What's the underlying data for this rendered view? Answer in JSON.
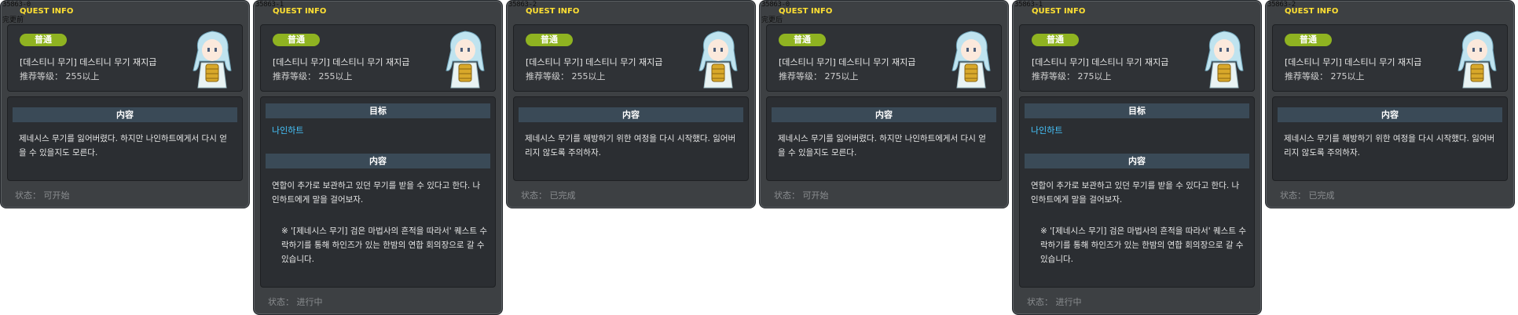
{
  "panels": [
    {
      "code": "35863-0",
      "title": "QUEST INFO",
      "subline": "完更前",
      "badge": "普通",
      "quest_name": "[데스티니 무기] 데스티니 무기 재지급",
      "level": "推荐等级： 255以上",
      "content_header": "内容",
      "content": "제네시스 무기를 잃어버렸다. 하지만 나인하트에게서 다시 얻을 수 있을지도 모른다.",
      "status": "状态： 可开始"
    },
    {
      "code": "35863-1",
      "title": "QUEST INFO",
      "subline": "",
      "badge": "普通",
      "quest_name": "[데스티니 무기] 데스티니 무기 재지급",
      "level": "推荐等级： 255以上",
      "target_header": "目标",
      "target": "나인하트",
      "content_header": "内容",
      "content": "연합이 추가로 보관하고 있던 무기를 받을 수 있다고 한다. 나인하트에게 말을 걸어보자.",
      "note": "※ '[제네시스 무기] 검은 마법사의 흔적을 따라서' 퀘스트 수락하기를 통해 하인즈가 있는 한밤의 연합 회의장으로 갈 수 있습니다.",
      "status": "状态： 进行中"
    },
    {
      "code": "35863-2",
      "title": "QUEST INFO",
      "subline": "",
      "badge": "普通",
      "quest_name": "[데스티니 무기] 데스티니 무기 재지급",
      "level": "推荐等级： 255以上",
      "content_header": "内容",
      "content": "제네시스 무기를 해방하기 위한 여정을 다시 시작했다. 잃어버리지 않도록 주의하자.",
      "status": "状态： 已完成"
    },
    {
      "code": "35863-0",
      "title": "QUEST INFO",
      "subline": "完更后",
      "badge": "普通",
      "quest_name": "[데스티니 무기] 데스티니 무기 재지급",
      "level": "推荐等级： 275以上",
      "content_header": "内容",
      "content": "제네시스 무기를 잃어버렸다. 하지만 나인하트에게서 다시 얻을 수 있을지도 모른다.",
      "status": "状态： 可开始"
    },
    {
      "code": "35863-1",
      "title": "QUEST INFO",
      "subline": "",
      "badge": "普通",
      "quest_name": "[데스티니 무기] 데스티니 무기 재지급",
      "level": "推荐等级： 275以上",
      "target_header": "目标",
      "target": "나인하트",
      "content_header": "内容",
      "content": "연합이 추가로 보관하고 있던 무기를 받을 수 있다고 한다. 나인하트에게 말을 걸어보자.",
      "note": "※ '[제네시스 무기] 검은 마법사의 흔적을 따라서' 퀘스트 수락하기를 통해 하인즈가 있는 한밤의 연합 회의장으로 갈 수 있습니다.",
      "status": "状态： 进行中"
    },
    {
      "code": "35863-2",
      "title": "QUEST INFO",
      "subline": "",
      "badge": "普通",
      "quest_name": "[데스티니 무기] 데스티니 무기 재지급",
      "level": "推荐等级： 275以上",
      "content_header": "内容",
      "content": "제네시스 무기를 해방하기 위한 여정을 다시 시작했다. 잃어버리지 않도록 주의하자.",
      "status": "状态： 已完成"
    }
  ],
  "colors": {
    "badge": "#8fb321",
    "title": "#ffe033",
    "target": "#46c6ff",
    "section_header": "#3a4a57"
  }
}
